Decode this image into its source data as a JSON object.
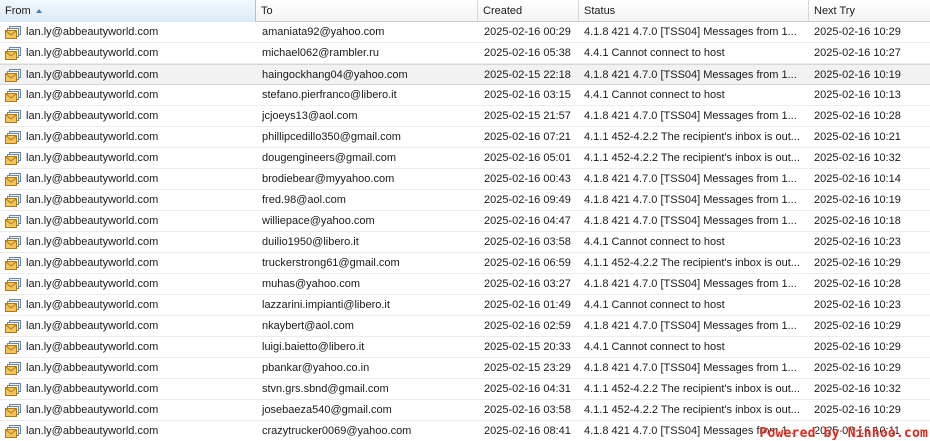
{
  "columns": [
    {
      "key": "from",
      "label": "From",
      "sorted": true
    },
    {
      "key": "to",
      "label": "To"
    },
    {
      "key": "created",
      "label": "Created"
    },
    {
      "key": "status",
      "label": "Status"
    },
    {
      "key": "next_try",
      "label": "Next Try"
    }
  ],
  "rows": [
    {
      "from": "lan.ly@abbeautyworld.com",
      "to": "amaniata92@yahoo.com",
      "created": "2025-02-16 00:29",
      "status": "4.1.8 421 4.7.0 [TSS04] Messages from 1...",
      "next_try": "2025-02-16 10:29"
    },
    {
      "from": "lan.ly@abbeautyworld.com",
      "to": "michael062@rambler.ru",
      "created": "2025-02-16 05:38",
      "status": "4.4.1 Cannot connect to host",
      "next_try": "2025-02-16 10:27"
    },
    {
      "from": "lan.ly@abbeautyworld.com",
      "to": "haingockhang04@yahoo.com",
      "created": "2025-02-15 22:18",
      "status": "4.1.8 421 4.7.0 [TSS04] Messages from 1...",
      "next_try": "2025-02-16 10:19"
    },
    {
      "from": "lan.ly@abbeautyworld.com",
      "to": "stefano.pierfranco@libero.it",
      "created": "2025-02-16 03:15",
      "status": "4.4.1 Cannot connect to host",
      "next_try": "2025-02-16 10:13"
    },
    {
      "from": "lan.ly@abbeautyworld.com",
      "to": "jcjoeys13@aol.com",
      "created": "2025-02-15 21:57",
      "status": "4.1.8 421 4.7.0 [TSS04] Messages from 1...",
      "next_try": "2025-02-16 10:28"
    },
    {
      "from": "lan.ly@abbeautyworld.com",
      "to": "phillipcedillo350@gmail.com",
      "created": "2025-02-16 07:21",
      "status": "4.1.1 452-4.2.2 The recipient's inbox is out...",
      "next_try": "2025-02-16 10:21"
    },
    {
      "from": "lan.ly@abbeautyworld.com",
      "to": "dougengineers@gmail.com",
      "created": "2025-02-16 05:01",
      "status": "4.1.1 452-4.2.2 The recipient's inbox is out...",
      "next_try": "2025-02-16 10:32"
    },
    {
      "from": "lan.ly@abbeautyworld.com",
      "to": "brodiebear@myyahoo.com",
      "created": "2025-02-16 00:43",
      "status": "4.1.8 421 4.7.0 [TSS04] Messages from 1...",
      "next_try": "2025-02-16 10:14"
    },
    {
      "from": "lan.ly@abbeautyworld.com",
      "to": "fred.98@aol.com",
      "created": "2025-02-16 09:49",
      "status": "4.1.8 421 4.7.0 [TSS04] Messages from 1...",
      "next_try": "2025-02-16 10:19"
    },
    {
      "from": "lan.ly@abbeautyworld.com",
      "to": "williepace@yahoo.com",
      "created": "2025-02-16 04:47",
      "status": "4.1.8 421 4.7.0 [TSS04] Messages from 1...",
      "next_try": "2025-02-16 10:18"
    },
    {
      "from": "lan.ly@abbeautyworld.com",
      "to": "duilio1950@libero.it",
      "created": "2025-02-16 03:58",
      "status": "4.4.1 Cannot connect to host",
      "next_try": "2025-02-16 10:23"
    },
    {
      "from": "lan.ly@abbeautyworld.com",
      "to": "truckerstrong61@gmail.com",
      "created": "2025-02-16 06:59",
      "status": "4.1.1 452-4.2.2 The recipient's inbox is out...",
      "next_try": "2025-02-16 10:29"
    },
    {
      "from": "lan.ly@abbeautyworld.com",
      "to": "muhas@yahoo.com",
      "created": "2025-02-16 03:27",
      "status": "4.1.8 421 4.7.0 [TSS04] Messages from 1...",
      "next_try": "2025-02-16 10:28"
    },
    {
      "from": "lan.ly@abbeautyworld.com",
      "to": "lazzarini.impianti@libero.it",
      "created": "2025-02-16 01:49",
      "status": "4.4.1 Cannot connect to host",
      "next_try": "2025-02-16 10:23"
    },
    {
      "from": "lan.ly@abbeautyworld.com",
      "to": "nkaybert@aol.com",
      "created": "2025-02-16 02:59",
      "status": "4.1.8 421 4.7.0 [TSS04] Messages from 1...",
      "next_try": "2025-02-16 10:29"
    },
    {
      "from": "lan.ly@abbeautyworld.com",
      "to": "luigi.baietto@libero.it",
      "created": "2025-02-15 20:33",
      "status": "4.4.1 Cannot connect to host",
      "next_try": "2025-02-16 10:29"
    },
    {
      "from": "lan.ly@abbeautyworld.com",
      "to": "pbankar@yahoo.co.in",
      "created": "2025-02-15 23:29",
      "status": "4.1.8 421 4.7.0 [TSS04] Messages from 1...",
      "next_try": "2025-02-16 10:29"
    },
    {
      "from": "lan.ly@abbeautyworld.com",
      "to": "stvn.grs.sbnd@gmail.com",
      "created": "2025-02-16 04:31",
      "status": "4.1.1 452-4.2.2 The recipient's inbox is out...",
      "next_try": "2025-02-16 10:32"
    },
    {
      "from": "lan.ly@abbeautyworld.com",
      "to": "josebaeza540@gmail.com",
      "created": "2025-02-16 03:58",
      "status": "4.1.1 452-4.2.2 The recipient's inbox is out...",
      "next_try": "2025-02-16 10:29"
    },
    {
      "from": "lan.ly@abbeautyworld.com",
      "to": "crazytrucker0069@yahoo.com",
      "created": "2025-02-16 08:41",
      "status": "4.1.8 421 4.7.0 [TSS04] Messages from 1...",
      "next_try": "2025-02-16 10:11"
    }
  ],
  "selected_row": 2,
  "row_icon": "envelope-icon",
  "watermark": "Powered by Ninhoo.com"
}
